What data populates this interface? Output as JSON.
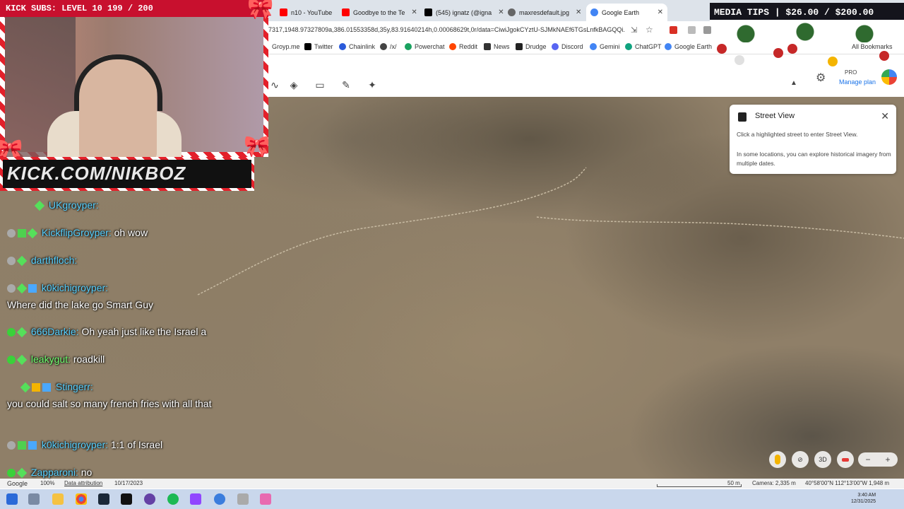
{
  "browser": {
    "tabs": [
      {
        "label": "n10 - YouTube",
        "color": "#ff0000"
      },
      {
        "label": "Goodbye to the Te",
        "color": "#ff0000"
      },
      {
        "label": "(545) ignatz (@igna",
        "color": "#000000"
      },
      {
        "label": "maxresdefault.jpg",
        "color": "#555555"
      },
      {
        "label": "Google Earth",
        "color": "#4285f4"
      }
    ],
    "url": "7317,1948.97327809a,386.01553358d,35y,83.91640214h,0.00068629t,0r/data=CiwiJgokCYztU-SJMkNAEf6TGsLnfkBAGQQi..."
  },
  "bookmarks": [
    {
      "label": "Groyp.me",
      "color": "#888888"
    },
    {
      "label": "Twitter",
      "color": "#000000"
    },
    {
      "label": "Chainlink",
      "color": "#2a5ada"
    },
    {
      "label": "/x/",
      "color": "#444444"
    },
    {
      "label": "Powerchat",
      "color": "#1aa260"
    },
    {
      "label": "Reddit",
      "color": "#ff4500"
    },
    {
      "label": "News",
      "color": "#333333"
    },
    {
      "label": "Drudge",
      "color": "#222222"
    },
    {
      "label": "Discord",
      "color": "#5865f2"
    },
    {
      "label": "Gemini",
      "color": "#4285f4"
    },
    {
      "label": "ChatGPT",
      "color": "#10a37f"
    },
    {
      "label": "Google Earth",
      "color": "#4285f4"
    }
  ],
  "all_bookmarks": "All Bookmarks",
  "earth": {
    "pro_label": "PRO",
    "manage_plan": "Manage plan",
    "street_view": {
      "title": "Street View",
      "line1": "Click a highlighted street to enter Street View.",
      "line2": "In some locations, you can explore historical imagery from multiple dates."
    },
    "btn_3d": "3D",
    "status": {
      "google": "Google",
      "zoom": "100%",
      "attribution": "Data attribution",
      "date": "10/17/2023",
      "scale": "50 m",
      "camera": "Camera: 2,335 m",
      "coords": "40°58'00\"N 112°13'00\"W  1,948 m"
    }
  },
  "overlay": {
    "kick_subs": "KICK SUBS: LEVEL 10 199 / 200",
    "kick_url": "KICK.COM/NIKBOZ",
    "media_tips": "MEDIA TIPS | $26.00 / $200.00"
  },
  "chat": [
    {
      "user": "UKgroyper:",
      "text": "",
      "top": 0
    },
    {
      "user": "KickflipGroyper:",
      "text": "oh wow"
    },
    {
      "user": "darthfloch:",
      "text": ""
    },
    {
      "user": "k0kichigroyper:",
      "text": ""
    },
    {
      "user": "",
      "text": "Where did the lake go Smart Guy"
    },
    {
      "user": "666Darkie:",
      "text": "Oh yeah just like the Israel a"
    },
    {
      "user": "leakygut:",
      "text": "roadkill"
    },
    {
      "user": "Stingerr:",
      "text": ""
    },
    {
      "user": "",
      "text": "you could salt so many french fries with all that"
    },
    {
      "user": "k0kichigroyper:",
      "text": "1:1 of Israel"
    },
    {
      "user": "Zapparoni:",
      "text": "no"
    }
  ],
  "taskbar": {
    "time": "3:40 AM",
    "date": "12/31/2025"
  }
}
